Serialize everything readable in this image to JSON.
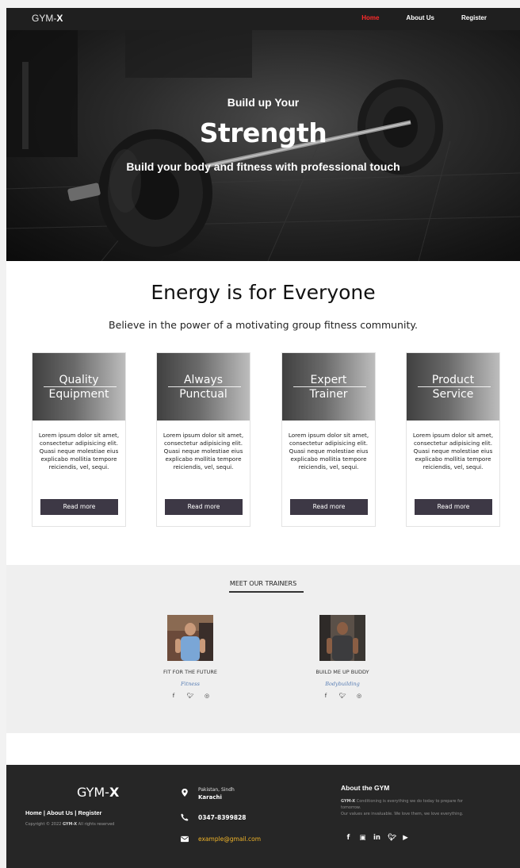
{
  "nav": {
    "brand_prefix": "GYM-",
    "brand_suffix": "X",
    "links": [
      {
        "label": "Home",
        "active": true
      },
      {
        "label": "About Us",
        "active": false
      },
      {
        "label": "Register",
        "active": false
      }
    ]
  },
  "hero": {
    "small": "Build up Your",
    "big": "Strength",
    "sub": "Build your body and fitness with professional touch"
  },
  "energy": {
    "title": "Energy is for Everyone",
    "subtitle": "Believe in the power of a motivating group fitness community."
  },
  "cards": [
    {
      "title_line1": "Quality",
      "title_line2": "Equipment",
      "body": "Lorem ipsum dolor sit amet, consectetur adipisicing elit. Quasi neque molestiae eius explicabo mollitia tempore reiciendis, vel, sequi.",
      "button": "Read more"
    },
    {
      "title_line1": "Always",
      "title_line2": "Punctual",
      "body": "Lorem ipsum dolor sit amet, consectetur adipisicing elit. Quasi neque molestiae eius explicabo mollitia tempore reiciendis, vel, sequi.",
      "button": "Read more"
    },
    {
      "title_line1": "Expert",
      "title_line2": "Trainer",
      "body": "Lorem ipsum dolor sit amet, consectetur adipisicing elit. Quasi neque molestiae eius explicabo mollitia tempore reiciendis, vel, sequi.",
      "button": "Read more"
    },
    {
      "title_line1": "Product",
      "title_line2": "Service",
      "body": "Lorem ipsum dolor sit amet, consectetur adipisicing elit. Quasi neque molestiae eius explicabo mollitia tempore reiciendis, vel, sequi.",
      "button": "Read more"
    }
  ],
  "trainers": {
    "title": "MEET OUR TRAINERS",
    "items": [
      {
        "name": "FIT FOR THE FUTURE",
        "role": "Fitness",
        "socials": [
          "facebook-icon",
          "twitter-icon",
          "instagram-icon"
        ]
      },
      {
        "name": "BUILD ME UP BUDDY",
        "role": "Bodybuilding",
        "socials": [
          "facebook-icon",
          "twitter-icon",
          "instagram-icon"
        ]
      }
    ]
  },
  "footer": {
    "brand_prefix": "GYM-",
    "brand_suffix": "X",
    "links": [
      "Home",
      "About Us",
      "Register"
    ],
    "link_separator": " | ",
    "copyright_prefix": "Copyright © 2022 ",
    "copyright_brand": "GYM-X",
    "copyright_suffix": " All rights reserved",
    "address_line1": "Pakistan, Sindh",
    "address_line2": "Karachi",
    "phone": "0347-8399828",
    "email": "example@gmail.com",
    "about_title": "About the GYM",
    "about_brand": "GYM-X",
    "about_text1": " Conditioning is everything we do today to prepare for tomorrow.",
    "about_text2": "Our values are invaluable. We love them, we love everything.",
    "socials": [
      "facebook-icon",
      "instagram-icon",
      "linkedin-icon",
      "twitter-icon",
      "youtube-icon"
    ]
  },
  "colors": {
    "nav_bg": "#1f1f1f",
    "active_link": "#ff2b2b",
    "button_bg": "#3d3845",
    "trainers_bg": "#efefef",
    "footer_bg": "#262626",
    "email_link": "#f0b429",
    "role_text": "#5a7fb5"
  }
}
